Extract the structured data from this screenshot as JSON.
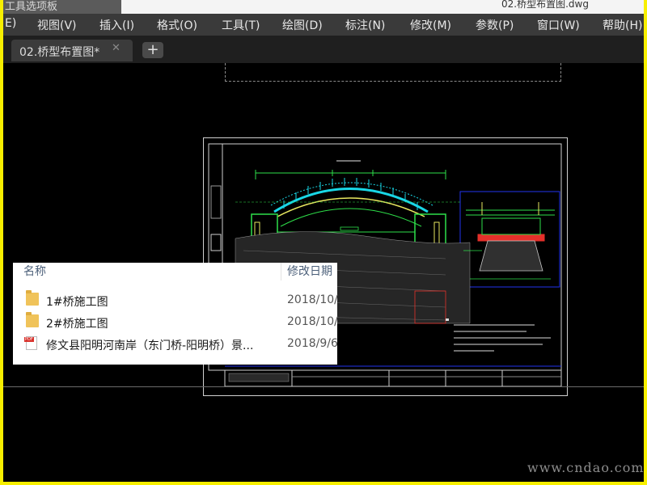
{
  "window": {
    "title_left": "工具选项板",
    "title_right": "02.桥型布置图.dwg"
  },
  "menu": [
    "E)",
    "视图(V)",
    "插入(I)",
    "格式(O)",
    "工具(T)",
    "绘图(D)",
    "标注(N)",
    "修改(M)",
    "参数(P)",
    "窗口(W)",
    "帮助(H)"
  ],
  "tab": {
    "label": "02.桥型布置图*",
    "close": "✕",
    "add": "+"
  },
  "file_list": {
    "header_name": "名称",
    "header_date": "修改日期",
    "items": [
      {
        "name": "1#桥施工图",
        "date": "2018/10/",
        "type": "folder"
      },
      {
        "name": "2#桥施工图",
        "date": "2018/10/",
        "type": "folder"
      },
      {
        "name": "修文县阳明河南岸（东门桥-阳明桥）景...",
        "date": "2018/9/6",
        "type": "pdf"
      }
    ]
  },
  "watermark": "www.cndao.com",
  "colors": {
    "outer_border": "#f7ef00",
    "menubar_bg": "#3a3a3a",
    "canvas_bg": "#000000",
    "drawing_cyan": "#19d7e6",
    "drawing_green": "#2ee04a",
    "drawing_red": "#e4302a",
    "drawing_blue": "#2233ee"
  }
}
